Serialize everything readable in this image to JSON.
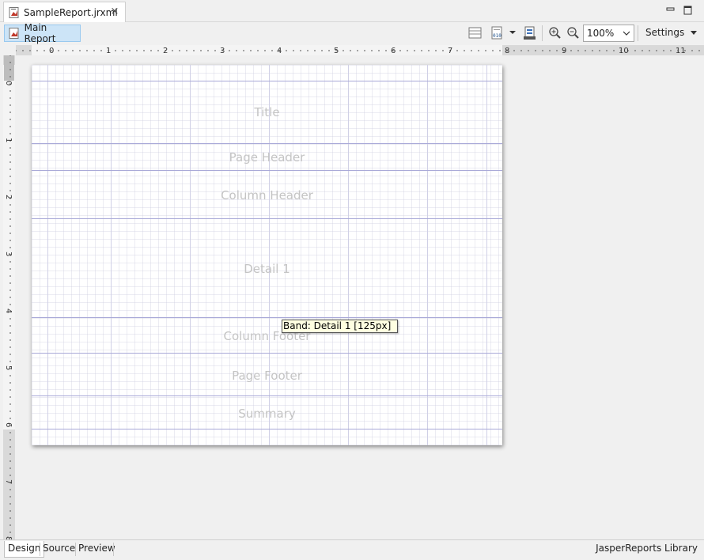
{
  "editor_tab": {
    "file_name": "SampleReport.jrxml",
    "close_glyph": "×"
  },
  "toolbar": {
    "main_report_label": "Main Report",
    "zoom_value": "100%",
    "settings_label": "Settings",
    "icons": [
      "bands-icon",
      "dataset-icon",
      "dropdown-caret-icon",
      "report-export-icon",
      "zoom-in-icon",
      "zoom-out-icon"
    ]
  },
  "rulers": {
    "horizontal_ticks": [
      "0",
      "1",
      "2",
      "3",
      "4",
      "5",
      "6",
      "7",
      "8",
      "9",
      "10",
      "11"
    ],
    "vertical_ticks": [
      "0",
      "1",
      "2",
      "3",
      "4",
      "5",
      "6",
      "7",
      "8"
    ]
  },
  "bands": [
    {
      "name": "Title"
    },
    {
      "name": "Page Header"
    },
    {
      "name": "Column Header"
    },
    {
      "name": "Detail 1"
    },
    {
      "name": "Column Footer"
    },
    {
      "name": "Page Footer"
    },
    {
      "name": "Summary"
    }
  ],
  "tooltip": {
    "text": "Band: Detail 1 [125px]"
  },
  "bottom_tabs": [
    {
      "label": "Design",
      "active": true
    },
    {
      "label": "Source",
      "active": false
    },
    {
      "label": "Preview",
      "active": false
    }
  ],
  "status": {
    "library_label": "JasperReports Library"
  }
}
